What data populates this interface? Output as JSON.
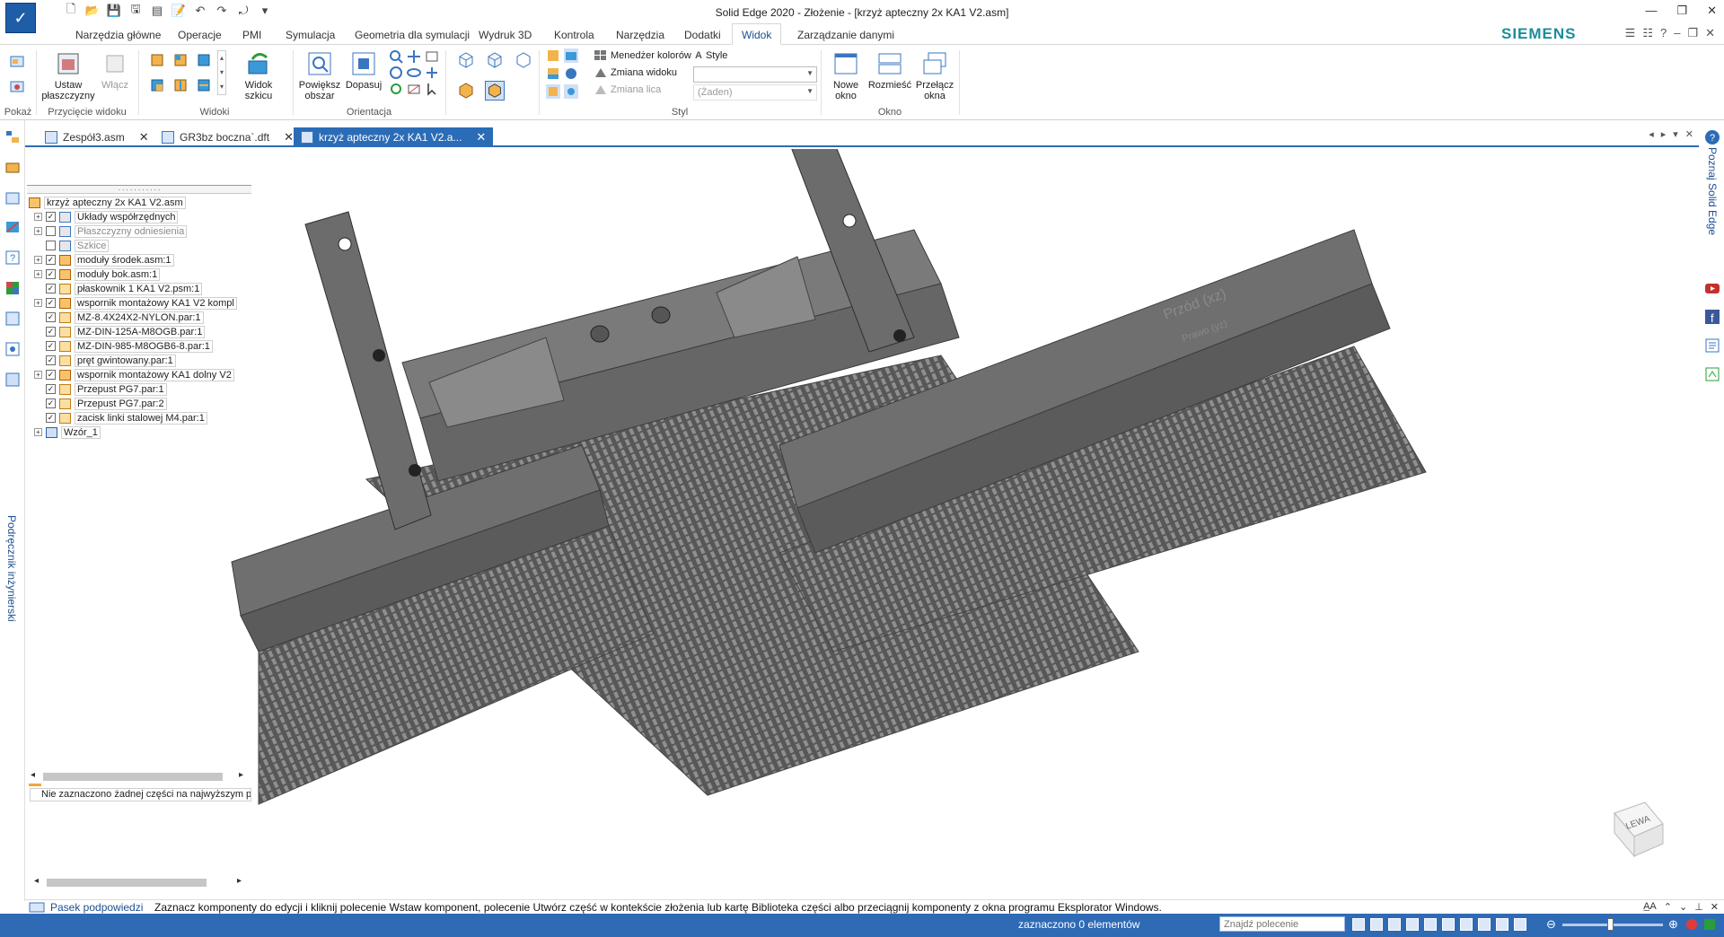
{
  "window": {
    "title": "Solid Edge 2020 - Złożenie - [krzyż apteczny 2x KA1 V2.asm]",
    "brand": "SIEMENS"
  },
  "ribbon_tabs": [
    "Narzędzia główne",
    "Operacje",
    "PMI",
    "Symulacja",
    "Geometria dla symulacji",
    "Wydruk 3D",
    "Kontrola",
    "Narzędzia",
    "Dodatki",
    "Widok",
    "Zarządzanie danymi"
  ],
  "active_ribbon_tab": "Widok",
  "ribbon": {
    "pokaz": {
      "label": "Pokaż"
    },
    "przyciecie": {
      "label": "Przycięcie widoku",
      "ustaw": "Ustaw płaszczyzny",
      "wlacz": "Włącz"
    },
    "widoki": {
      "label": "Widoki",
      "widok_szkicu": "Widok szkicu"
    },
    "orientacja": {
      "label": "Orientacja",
      "powieksz": "Powiększ obszar",
      "dopasuj": "Dopasuj"
    },
    "styl": {
      "label": "Styl",
      "menedzer": "Menedżer kolorów",
      "zmiana_widoku": "Zmiana widoku",
      "zmiana_lica": "Zmiana lica",
      "style": "Style",
      "combo2_value": "(Żaden)"
    },
    "okno": {
      "label": "Okno",
      "nowe": "Nowe okno",
      "rozmiesc": "Rozmieść",
      "przelacz": "Przełącz okna"
    }
  },
  "doc_tabs": [
    {
      "label": "Zespół3.asm"
    },
    {
      "label": "GR3bz boczna`.dft"
    },
    {
      "label": "krzyż apteczny 2x KA1 V2.a..."
    }
  ],
  "tree": {
    "root": "krzyż apteczny 2x KA1 V2.asm",
    "items": [
      {
        "label": "Układy współrzędnych"
      },
      {
        "label": "Płaszczyzny odniesienia"
      },
      {
        "label": "Szkice"
      },
      {
        "label": "moduły środek.asm:1"
      },
      {
        "label": "moduły bok.asm:1"
      },
      {
        "label": "płaskownik 1 KA1 V2.psm:1"
      },
      {
        "label": "wspornik montażowy KA1 V2 kompl"
      },
      {
        "label": "MZ-8.4X24X2-NYLON.par:1"
      },
      {
        "label": "MZ-DIN-125A-M8OGB.par:1"
      },
      {
        "label": "MZ-DIN-985-M8OGB6-8.par:1"
      },
      {
        "label": "pręt gwintowany.par:1"
      },
      {
        "label": "wspornik montażowy KA1 dolny V2"
      },
      {
        "label": "Przepust PG7.par:1"
      },
      {
        "label": "Przepust PG7.par:2"
      },
      {
        "label": "zacisk linki stalowej M4.par:1"
      },
      {
        "label": "Wzór_1"
      }
    ],
    "status": "Nie zaznaczono żadnej części na najwyższym po"
  },
  "viewport": {
    "plane_label_1": "Przód (xz)",
    "plane_label_2": "Prawo (yz)",
    "cube_label": "LEWA"
  },
  "prompt": {
    "left_label": "Pasek podpowiedzi",
    "text": "Zaznacz komponenty do edycji i kliknij polecenie Wstaw komponent, polecenie Utwórz część w kontekście złożenia lub kartę Biblioteka części albo przeciągnij komponenty z okna programu Eksplorator Windows."
  },
  "status": {
    "selection": "zaznaczono 0 elementów",
    "find_placeholder": "Znajdź polecenie"
  },
  "side_labels": {
    "left": "Podręcznik inżynierski",
    "right": "Poznaj Solid Edge"
  },
  "colors": {
    "accent": "#2b6cb7",
    "model": "#6f6f6f",
    "brand": "#1c8c9c"
  }
}
